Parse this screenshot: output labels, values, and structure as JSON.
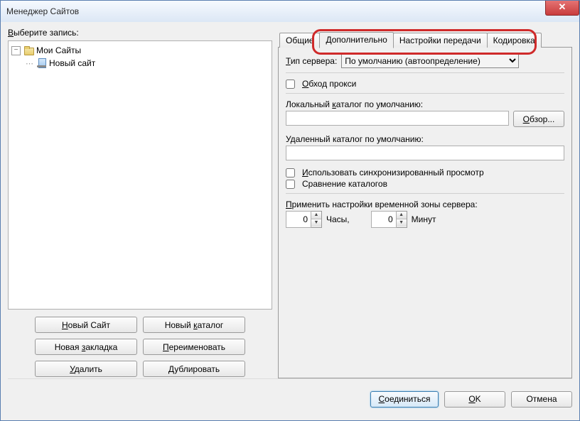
{
  "window": {
    "title": "Менеджер Сайтов"
  },
  "left": {
    "select_label": "Выберите запись:",
    "select_label_ukey": "В",
    "tree": {
      "root": "Мои Сайты",
      "child": "Новый сайт"
    },
    "buttons": {
      "new_site": "Новый Сайт",
      "new_site_u": "Н",
      "new_folder": "Новый каталог",
      "new_folder_u": "к",
      "new_bookmark": "Новая закладка",
      "new_bookmark_u": "з",
      "rename": "Переименовать",
      "rename_u": "П",
      "delete": "Удалить",
      "delete_u": "У",
      "duplicate": "Дублировать",
      "duplicate_u": "Д"
    }
  },
  "tabs": {
    "general": "Общие",
    "advanced": "Дополнительно",
    "transfer": "Настройки передачи",
    "charset": "Кодировка"
  },
  "panel": {
    "server_type_label": "Тип сервера:",
    "server_type_u": "Т",
    "server_type_value": "По умолчанию (автоопределение)",
    "bypass_proxy": "Обход прокси",
    "bypass_proxy_u": "О",
    "local_dir_label": "Локальный каталог по умолчанию:",
    "local_dir_u": "к",
    "browse": "Обзор...",
    "browse_u": "О",
    "remote_dir_label": "Удаленный каталог по умолчанию:",
    "sync_browse": "Использовать синхронизированный просмотр",
    "sync_browse_u": "И",
    "compare_dirs": "Сравнение каталогов",
    "tz_label": "Применить настройки временной зоны сервера:",
    "tz_label_u": "П",
    "hours_value": "0",
    "hours_label": "Часы,",
    "minutes_value": "0",
    "minutes_label": "Минут"
  },
  "footer": {
    "connect": "Соединиться",
    "connect_u": "С",
    "ok": "OK",
    "ok_u": "O",
    "cancel": "Отмена"
  }
}
